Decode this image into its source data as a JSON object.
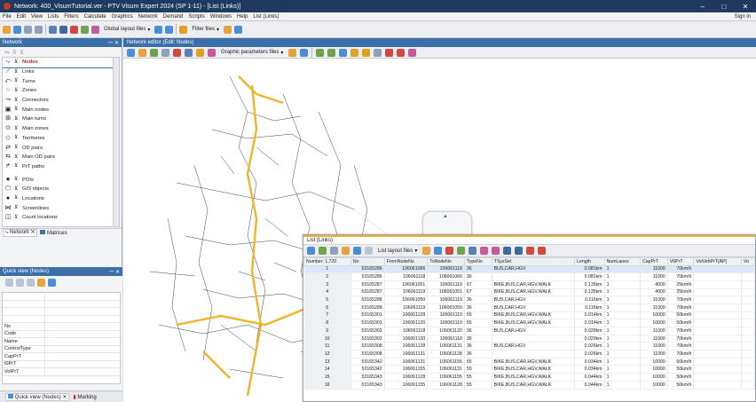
{
  "window": {
    "title": "Network: 400_VisumTutorial.ver - PTV Visum Expert 2024 (SP 1-11) - [List (Links)]",
    "min": "–",
    "max": "□",
    "close": "✕"
  },
  "menu": {
    "items": [
      "File",
      "Edit",
      "View",
      "Lists",
      "Filters",
      "Calculate",
      "Graphics",
      "Network",
      "Demand",
      "Scripts",
      "Windows",
      "Help",
      "List (Links)"
    ],
    "sign_in": "Sign in"
  },
  "toolbar": {
    "global_layout": "Global layout files",
    "filter_files": "Filter files"
  },
  "network_panel": {
    "title": "Network",
    "pin": "ꟷ ✕",
    "items": [
      {
        "label": "Nodes",
        "icon": "node-icon",
        "glyph": "⤷",
        "selected": true
      },
      {
        "label": "Links",
        "icon": "link-icon",
        "glyph": "⟋"
      },
      {
        "label": "Turns",
        "icon": "turn-icon",
        "glyph": "⤺"
      },
      {
        "label": "Zones",
        "icon": "zone-icon",
        "glyph": "○"
      },
      {
        "label": "Connectors",
        "icon": "connector-icon",
        "glyph": "⊸"
      },
      {
        "label": "Main nodes",
        "icon": "main-node-icon",
        "glyph": "▣"
      },
      {
        "label": "Main turns",
        "icon": "main-turn-icon",
        "glyph": "⊞"
      },
      {
        "label": "Main zones",
        "icon": "main-zone-icon",
        "glyph": "⊙"
      },
      {
        "label": "Territories",
        "icon": "territory-icon",
        "glyph": "◇"
      },
      {
        "label": "OD pairs",
        "icon": "od-pair-icon",
        "glyph": "⇄"
      },
      {
        "label": "Main OD pairs",
        "icon": "main-od-pair-icon",
        "glyph": "⇆"
      },
      {
        "label": "PrT paths",
        "icon": "prt-path-icon",
        "glyph": "↱"
      },
      {
        "label": "POIs",
        "icon": "poi-icon",
        "glyph": "★"
      },
      {
        "label": "GIS objects",
        "icon": "gis-icon",
        "glyph": "⬡"
      },
      {
        "label": "Locations",
        "icon": "location-icon",
        "glyph": "●"
      },
      {
        "label": "Screenlines",
        "icon": "screenline-icon",
        "glyph": "⋈"
      },
      {
        "label": "Count locations",
        "icon": "count-location-icon",
        "glyph": "◫"
      }
    ],
    "tabs": {
      "network": "Network",
      "matrices": "Matrices"
    }
  },
  "quick_view": {
    "title": "Quick view (Nodes)",
    "fields": [
      "No",
      "Code",
      "Name",
      "ControlType",
      "CapPrT",
      "t0PrT",
      "VolPrT"
    ],
    "tab": "Quick view (Nodes)",
    "marking": "Marking"
  },
  "network_editor": {
    "title": "Network editor (Edit: Nodes)",
    "graphic_params": "Graphic parameters files"
  },
  "list": {
    "title": "List (Links)",
    "layout_files": "List layout files",
    "columns": [
      "Number: 1,720",
      "No",
      "FromNodeNo",
      "ToNodeNo",
      "TypeNo",
      "TSysSet",
      "Length",
      "NumLanes",
      "CapPrT",
      "V0PrT",
      "VolVehPrT(AP)",
      "Vo"
    ],
    "rows": [
      [
        "1",
        "53165286",
        "106061066",
        "106061118",
        "36",
        "BUS,CAR,HGV",
        "0.081km",
        "1",
        "11000",
        "70km/h"
      ],
      [
        "2",
        "53165286",
        "106061118",
        "106061066",
        "36",
        "",
        "0.081km",
        "1",
        "11000",
        "70km/h"
      ],
      [
        "3",
        "53165287",
        "106061051",
        "106061119",
        "67",
        "BIKE,BUS,CAR,HGV,WALK",
        "0.135km",
        "1",
        "4000",
        "25km/h"
      ],
      [
        "4",
        "53165287",
        "106061119",
        "106061051",
        "67",
        "BIKE,BUS,CAR,HGV,WALK",
        "0.135km",
        "1",
        "4000",
        "25km/h"
      ],
      [
        "5",
        "53165288",
        "106061050",
        "106061119",
        "36",
        "BUS,CAR,HGV",
        "0.116km",
        "1",
        "11000",
        "70km/h"
      ],
      [
        "6",
        "53165288",
        "106061119",
        "106061050",
        "36",
        "BUS,CAR,HGV",
        "0.116km",
        "1",
        "11000",
        "70km/h"
      ],
      [
        "7",
        "53165301",
        "106061128",
        "106061119",
        "55",
        "BIKE,BUS,CAR,HGV,WALK",
        "0.014km",
        "1",
        "10000",
        "50km/h"
      ],
      [
        "8",
        "53165301",
        "106061120",
        "106061119",
        "55",
        "BIKE,BUS,CAR,HGV,WALK",
        "0.014km",
        "1",
        "10000",
        "50km/h"
      ],
      [
        "9",
        "53165302",
        "106061118",
        "106061120",
        "36",
        "BUS,CAR,HGV",
        "0.029km",
        "1",
        "11000",
        "70km/h"
      ],
      [
        "10",
        "53165302",
        "106061120",
        "106061118",
        "36",
        "",
        "0.029km",
        "1",
        "11000",
        "70km/h"
      ],
      [
        "11",
        "53165308",
        "106061128",
        "106061131",
        "36",
        "BUS,CAR,HGV",
        "0.026km",
        "1",
        "11000",
        "70km/h"
      ],
      [
        "12",
        "53165308",
        "106061131",
        "106061128",
        "36",
        "",
        "0.026km",
        "1",
        "11000",
        "70km/h"
      ],
      [
        "13",
        "53165342",
        "106061131",
        "106061155",
        "55",
        "BIKE,BUS,CAR,HGV,WALK",
        "0.034km",
        "1",
        "10000",
        "50km/h"
      ],
      [
        "14",
        "53165342",
        "106061155",
        "106061131",
        "55",
        "BIKE,BUS,CAR,HGV,WALK",
        "0.034km",
        "1",
        "10000",
        "50km/h"
      ],
      [
        "15",
        "53165343",
        "106061128",
        "106061155",
        "55",
        "BIKE,BUS,CAR,HGV,WALK",
        "0.044km",
        "1",
        "10000",
        "50km/h"
      ],
      [
        "16",
        "53165343",
        "106061155",
        "106061128",
        "55",
        "BIKE,BUS,CAR,HGV,WALK",
        "0.044km",
        "1",
        "10000",
        "50km/h"
      ]
    ]
  },
  "colors": {
    "titlebar": "#1f3a5f",
    "panel_header": "#3c6fa8",
    "road": "#f0b429",
    "selected_label": "#c0272d"
  }
}
